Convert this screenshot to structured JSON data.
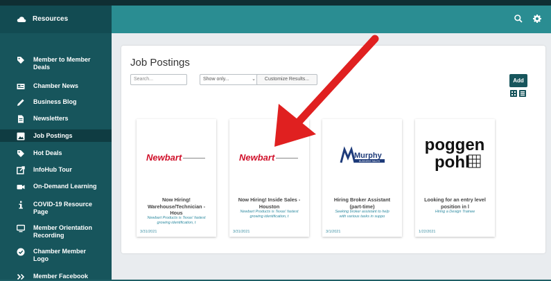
{
  "header": {
    "title": "Resources",
    "icons": [
      "search-icon",
      "gear-icon"
    ]
  },
  "sidebar": {
    "items": [
      {
        "label": "Member to Member\nDeals",
        "icon": "tag-icon"
      },
      {
        "label": "Chamber News",
        "icon": "newspaper-icon"
      },
      {
        "label": "Business Blog",
        "icon": "pencil-icon"
      },
      {
        "label": "Newsletters",
        "icon": "document-icon"
      },
      {
        "label": "Job Postings",
        "icon": "image-icon",
        "active": true
      },
      {
        "label": "Hot Deals",
        "icon": "tag-icon"
      },
      {
        "label": "InfoHub Tour",
        "icon": "external-link-icon"
      },
      {
        "label": "On-Demand Learning",
        "icon": "video-icon"
      },
      {
        "label": "COVID-19 Resource\nPage",
        "icon": "info-icon"
      },
      {
        "label": "Member Orientation\nRecording",
        "icon": "monitor-icon"
      },
      {
        "label": "Chamber Member\nLogo",
        "icon": "check-circle-icon"
      },
      {
        "label": "Member Facebook",
        "icon": "double-chevron-icon"
      }
    ]
  },
  "main": {
    "title": "Job Postings",
    "search_placeholder": "Search...",
    "filter_value": "Show only...",
    "customize_label": "Customize Results...",
    "add_label": "Add",
    "cards": [
      {
        "logo_text": "Newbart",
        "title": "Now Hiring!\nWarehouse/Technician -\nHous",
        "desc": "Newbart Products is Texas' fastest\ngrowing identification, t",
        "date": "3/31/2021"
      },
      {
        "logo_text": "Newbart",
        "title": "Now Hiring! Inside Sales -\nHouston",
        "desc": "Newbart Products is Texas' fastest\ngrowing identification, t",
        "date": "3/31/2021"
      },
      {
        "logo_text": "Murphy",
        "logo_sub": "BUSINESS SALES",
        "title": "Hiring Broker Assistant\n(part-time)",
        "desc": "Seeking broker assistant to help\nwith various tasks in suppo",
        "date": "3/1/2021"
      },
      {
        "logo_text": "poggen\npohl",
        "title": "Looking for an entry level\nposition in l",
        "desc": "Hiring a Design Trainee",
        "date": "1/22/2021"
      }
    ]
  },
  "colors": {
    "sidebar": "#17555c",
    "header": "#2a8d92",
    "accent_link": "#2d8aa0",
    "arrow": "#e02020",
    "newbart_red": "#d0102a"
  }
}
